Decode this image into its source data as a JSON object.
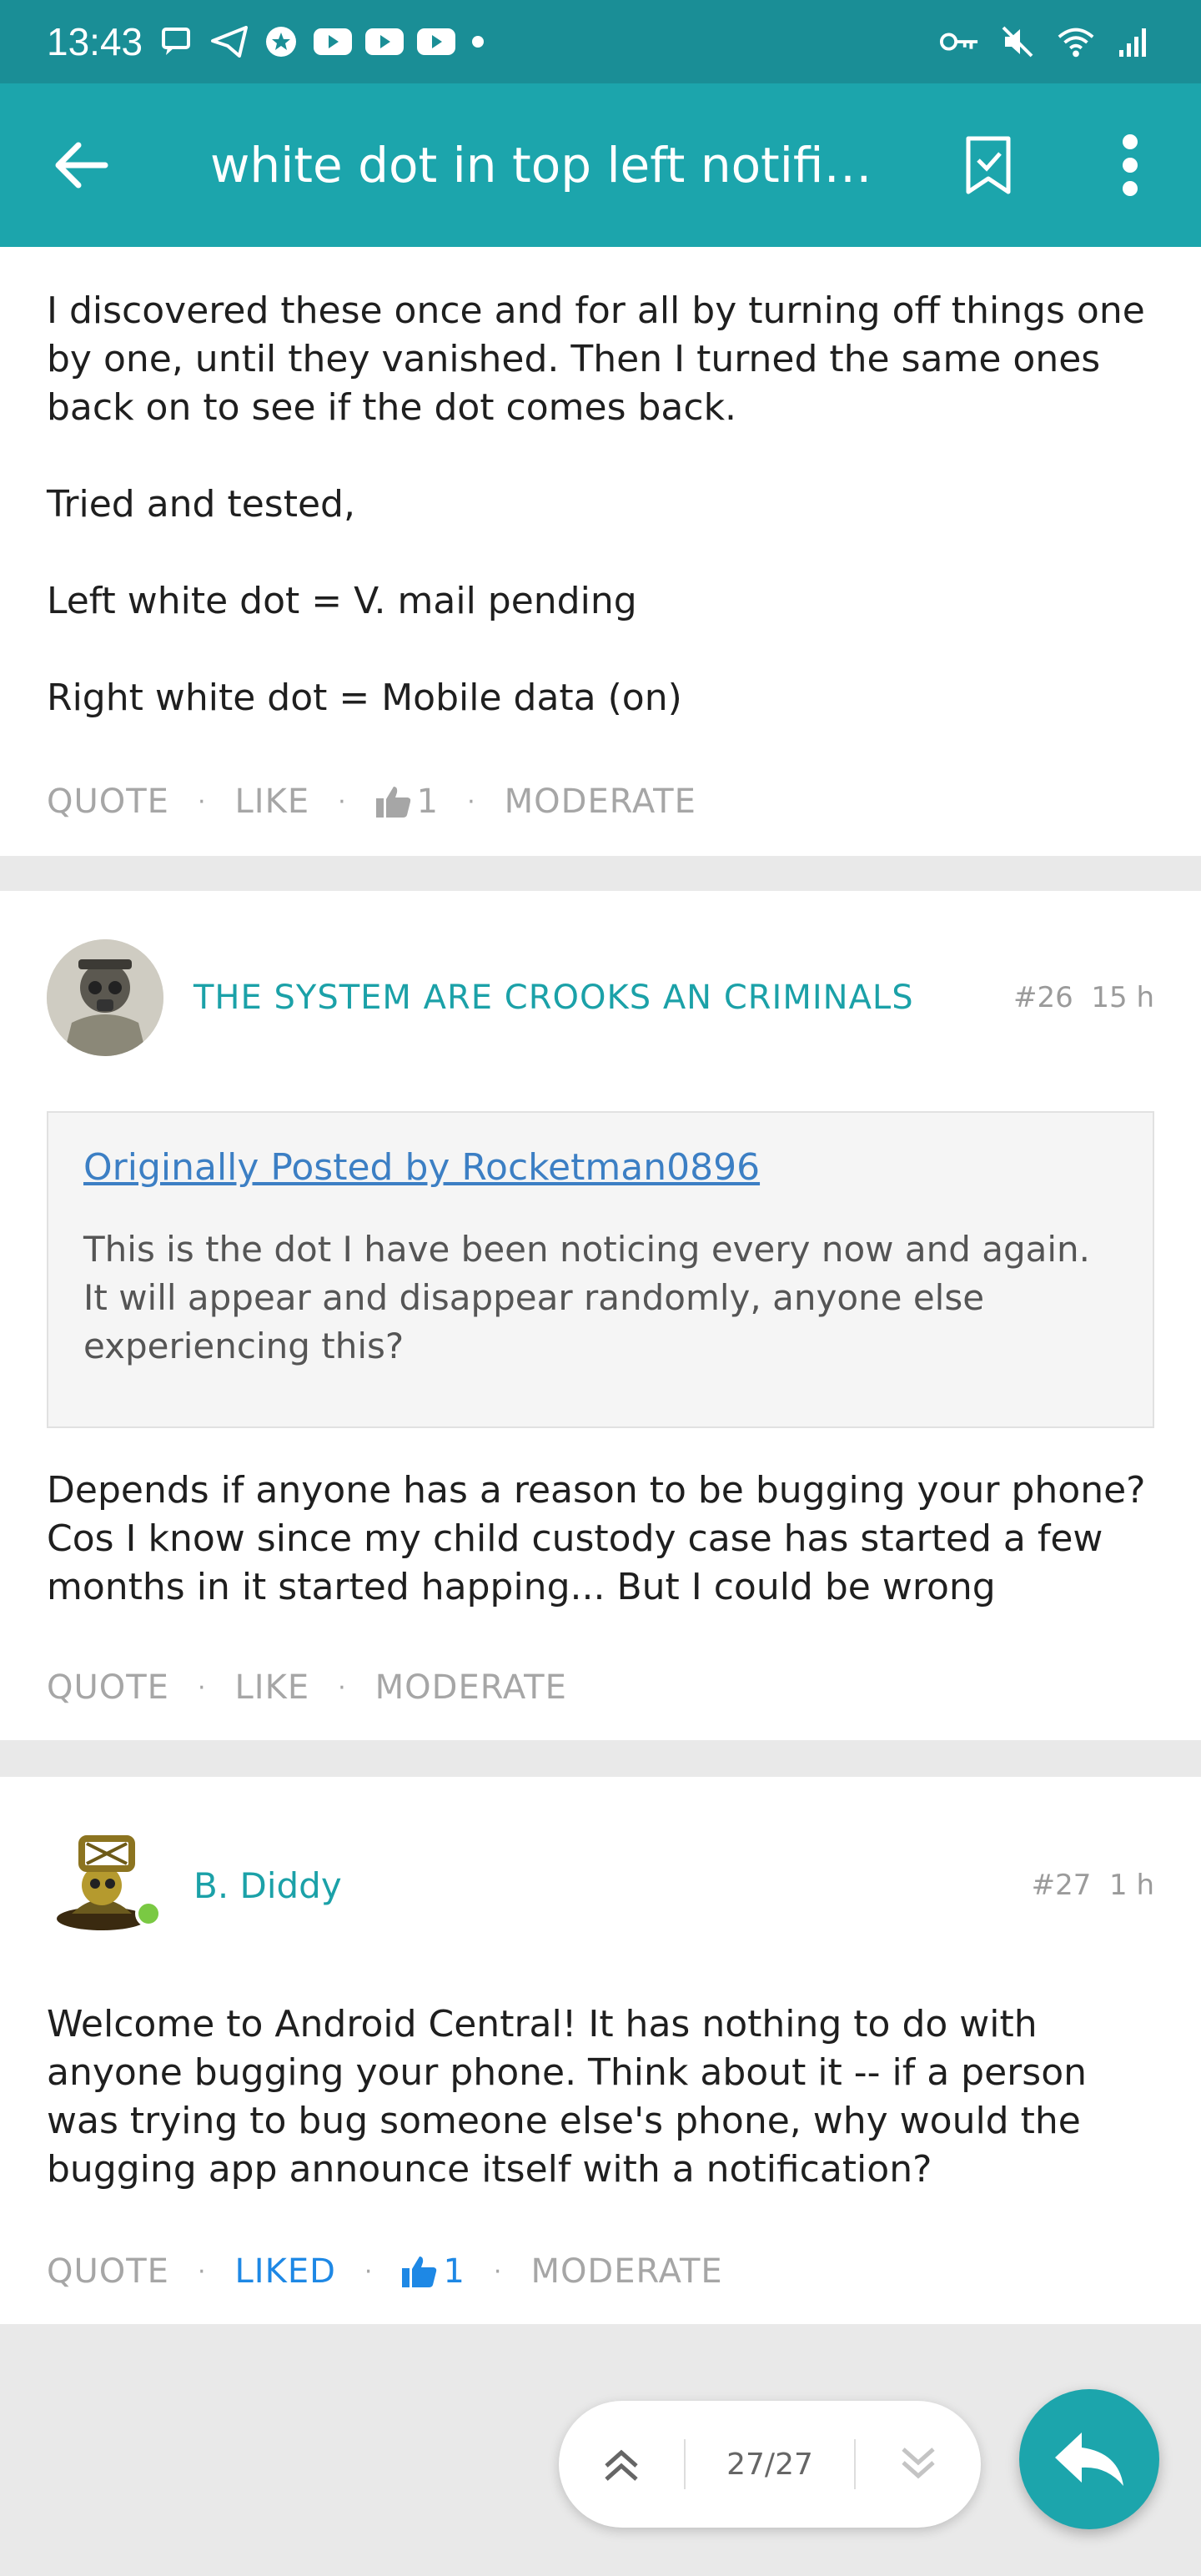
{
  "status_bar": {
    "time": "13:43",
    "notification_icons": [
      "message-icon",
      "telegram-icon",
      "star-app-icon",
      "youtube-icon",
      "youtube-icon",
      "youtube-icon",
      "dot-icon"
    ],
    "system_icons": [
      "vpn-key-icon",
      "mute-icon",
      "wifi-icon",
      "signal-icon"
    ]
  },
  "app_bar": {
    "title": "white dot in top left notifi…",
    "back_icon": "arrow-back-icon",
    "bookmark_icon": "bookmark-icon",
    "menu_icon": "more-vert-icon"
  },
  "posts": [
    {
      "body_lines": [
        "I discovered these once and for all by turning off things one by one, until they vanished. Then I turned the same ones back on to see if the dot comes back.",
        "Tried and tested,",
        "Left white dot = V. mail pending",
        "Right white dot = Mobile data (on)"
      ],
      "actions": {
        "quote": "QUOTE",
        "like": "LIKE",
        "like_count": "1",
        "moderate": "MODERATE"
      }
    },
    {
      "author": "THE SYSTEM ARE CROOKS AN CRIMINALS",
      "number": "#26",
      "age": "15 h",
      "quote": {
        "by": "Originally Posted by Rocketman0896",
        "text": "This is the dot I have been noticing every now and again. It will appear and disappear randomly, anyone else experiencing this?"
      },
      "body": "Depends if anyone has a reason to be bugging your phone? Cos I know since my child custody case has started a few months in it started happing... But I could be wrong",
      "actions": {
        "quote": "QUOTE",
        "like": "LIKE",
        "moderate": "MODERATE"
      }
    },
    {
      "author": "B. Diddy",
      "number": "#27",
      "age": "1 h",
      "online": true,
      "body": "Welcome to Android Central! It has nothing to do with anyone bugging your phone. Think about it -- if a person was trying to bug someone else's phone, why would the bugging app announce itself with a notification?",
      "actions": {
        "quote": "QUOTE",
        "liked": "LIKED",
        "like_count": "1",
        "moderate": "MODERATE"
      }
    }
  ],
  "pager": {
    "label": "27/27"
  },
  "colors": {
    "status_bar": "#1a8e96",
    "app_bar": "#1ca5ac",
    "author": "#1ba1a8",
    "liked": "#1e88e5",
    "link": "#3c7fc4"
  }
}
